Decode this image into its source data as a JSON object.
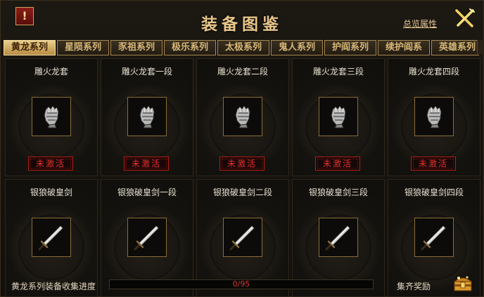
{
  "header": {
    "alert_icon": "!",
    "title": "装备图鉴",
    "attributes_link": "总览属性"
  },
  "tabs": [
    {
      "label": "黄龙系列",
      "active": true
    },
    {
      "label": "星陨系列",
      "active": false
    },
    {
      "label": "豕祖系列",
      "active": false
    },
    {
      "label": "极乐系列",
      "active": false
    },
    {
      "label": "太极系列",
      "active": false
    },
    {
      "label": "鬼人系列",
      "active": false
    },
    {
      "label": "护阎系列",
      "active": false
    },
    {
      "label": "续护阎系",
      "active": false
    },
    {
      "label": "英雄系列",
      "active": false
    }
  ],
  "cards": [
    {
      "name": "雕火龙套",
      "item": "gauntlet",
      "status": "未激活"
    },
    {
      "name": "雕火龙套一段",
      "item": "gauntlet",
      "status": "未激活"
    },
    {
      "name": "雕火龙套二段",
      "item": "gauntlet",
      "status": "未激活"
    },
    {
      "name": "雕火龙套三段",
      "item": "gauntlet",
      "status": "未激活"
    },
    {
      "name": "雕火龙套四段",
      "item": "gauntlet",
      "status": "未激活"
    },
    {
      "name": "银狼破皇剑",
      "item": "sword",
      "status": ""
    },
    {
      "name": "银狼破皇剑一段",
      "item": "sword",
      "status": ""
    },
    {
      "name": "银狼破皇剑二段",
      "item": "sword",
      "status": ""
    },
    {
      "name": "银狼破皇剑三段",
      "item": "sword",
      "status": ""
    },
    {
      "name": "银狼破皇剑四段",
      "item": "sword",
      "status": ""
    }
  ],
  "footer": {
    "progress_label": "黄龙系列装备收集进度",
    "progress_text": "0/95",
    "progress_value": 0,
    "progress_max": 95,
    "reward_label": "集齐奖励"
  },
  "colors": {
    "gold": "#e8c68a",
    "inactive_red": "#e8302a"
  }
}
